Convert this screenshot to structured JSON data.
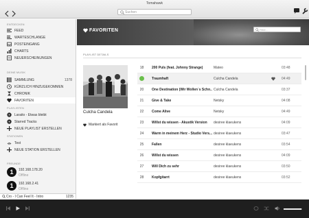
{
  "app": {
    "title": "Tomahawk",
    "search_placeholder": "Suchen",
    "nav_back_icon": "chevron-left-icon",
    "nav_forward_icon": "chevron-right-icon"
  },
  "sidebar": {
    "discover_header": "ENTDECKEN",
    "discover_items": [
      {
        "label": "FEED",
        "icon": "feed-icon"
      },
      {
        "label": "WARTESCHLANGE",
        "icon": "queue-icon"
      },
      {
        "label": "POSTEINGANG",
        "icon": "inbox-icon"
      },
      {
        "label": "CHARTS",
        "icon": "charts-icon"
      },
      {
        "label": "NEUERSCHEINUNGEN",
        "icon": "releases-icon"
      }
    ],
    "mymusic_header": "DEINE MUSIK",
    "mymusic_items": [
      {
        "label": "SAMMLUNG",
        "count": "1378",
        "icon": "collection-icon"
      },
      {
        "label": "KÜRZLICH HINZUGEKOMMEN",
        "icon": "recent-icon"
      },
      {
        "label": "CHRONIK",
        "icon": "history-icon"
      },
      {
        "label": "FAVORITEN",
        "icon": "heart-icon",
        "active": true
      }
    ],
    "playlists_header": "PLAYLISTEN",
    "playlists": [
      {
        "label": "Laraito - Etwas bleibt",
        "icon": "playlist-icon"
      },
      {
        "label": "Starred Tracks",
        "icon": "playlist-icon"
      },
      {
        "label": "NEUE PLAYLIST ERSTELLEN",
        "icon": "plus-icon"
      }
    ],
    "stations_header": "STATIONEN",
    "stations": [
      {
        "label": "Test",
        "icon": "station-icon"
      },
      {
        "label": "NEUE STATION ERSTELLEN",
        "icon": "plus-icon"
      }
    ],
    "friends_header": "FREUNDE",
    "friends": [
      {
        "ip": "192.168.178.20",
        "status": "Offline"
      },
      {
        "ip": "192.168.2.41",
        "status": "Offline"
      }
    ],
    "footer": {
      "query": "Cro - I Can Feel It - Intro",
      "count": "1235"
    }
  },
  "main": {
    "title": "FAVORITEN",
    "filter_placeholder": "Filter...",
    "details_label": "PLAYLIST DETAILS",
    "album_artist": "Culcha Candela",
    "favorite_label": "Markiert als Favorit",
    "tracks": [
      {
        "num": "18",
        "title": "200 Puls (feat. Johnny Strange)",
        "artist": "Mateo",
        "duration": "03:48"
      },
      {
        "num": "",
        "title": "Traumhaft",
        "artist": "Culcha Candela",
        "duration": "04:49",
        "playing": true,
        "loved": true
      },
      {
        "num": "20",
        "title": "One Destination (Wir Wollen´s Schn...",
        "artist": "Culcha Candela",
        "duration": "03:37"
      },
      {
        "num": "21",
        "title": "Give & Take",
        "artist": "Netsky",
        "duration": "04:08"
      },
      {
        "num": "22",
        "title": "Come Alive",
        "artist": "Netsky",
        "duration": "04:49"
      },
      {
        "num": "23",
        "title": "Willst du wissen - Akustik Version",
        "artist": "desiree klaeukens",
        "duration": "04:09"
      },
      {
        "num": "24",
        "title": "Warm in meinem Herz - Studio Vers...",
        "artist": "desiree klaeukens",
        "duration": "03:47"
      },
      {
        "num": "25",
        "title": "Fallen",
        "artist": "desiree klaeukens",
        "duration": "03:54"
      },
      {
        "num": "26",
        "title": "Willst du wissen",
        "artist": "desiree klaeukens",
        "duration": "04:09"
      },
      {
        "num": "27",
        "title": "Will Dich zu sehr",
        "artist": "desiree klaeukens",
        "duration": "03:50"
      },
      {
        "num": "28",
        "title": "Kopfgitarrt",
        "artist": "desiree klaeukens",
        "duration": "03:52"
      }
    ]
  },
  "player": {
    "volume": 0.95
  },
  "colors": {
    "playing_indicator": "#6abf4b",
    "player_bg": "#1f1f1f",
    "sidebar_bg": "#f3f3f3"
  }
}
